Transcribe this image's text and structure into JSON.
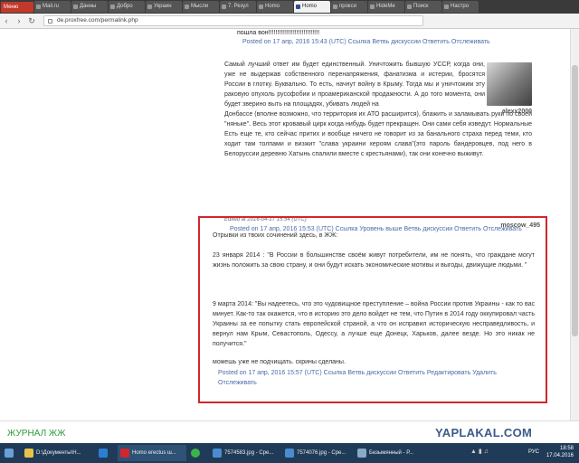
{
  "browser": {
    "menu_label": "Меню",
    "tabs": [
      {
        "label": "Mail.ru"
      },
      {
        "label": "Данны"
      },
      {
        "label": "Добро"
      },
      {
        "label": "Украин"
      },
      {
        "label": "Мысли"
      },
      {
        "label": "7. Резул"
      },
      {
        "label": "Homo"
      },
      {
        "label": "Homo",
        "active": true
      },
      {
        "label": "прокси"
      },
      {
        "label": "HideMe"
      },
      {
        "label": "Поиск"
      },
      {
        "label": "Настро"
      }
    ],
    "url": "de.proxfree.com/permalink.php"
  },
  "comments": {
    "top": {
      "truncated_text": "пошла вон!!!!!!!!!!!!!!!!!!!!!!!!!!!!!",
      "meta": "Posted on 17 апр, 2016 15:43 (UTC)  Ссылка Ветвь дискуссии Ответить Отслеживать"
    },
    "second": {
      "avatar_user": "alexx2000",
      "lead": "Самый лучший ответ им будет единственный. Уничтожить бывшую УССР, когда они, уже не выдержав собственного перенапряжения, фанатизма и истерии, бросятся России в глотку. Буквально. То есть, начнут войну в Крыму. Тогда мы и уничтожим эту раковую опухоль русофобии и проамериканской продажности. А до того момента, они будет зверино выть на площадях, убивать людей на",
      "body": "Донбассе (вполне возможно, что территория их АТО расширится), блажить и заламывать руки по своей \"няньке\". Весь этот кровавый цирк когда нибудь будет прекращен. Они сами себя изведут. Нормальные Есть еще те, кто сейчас притих и вообще ничего не говорит из за банального страха перед теми, кто ходит там толпами и визжит \"слава украини хероям слава\"(это пароль бандеровцев, под него в Белоруссии деревню Хатынь спалили вместе с крестьянами), так они конечно выживут.",
      "edited": "Edited at 2016-04-17 15:54 (UTC)",
      "meta": "Posted on 17 апр, 2016 15:53 (UTC)  Ссылка Уровень выше Ветвь дискуссии Ответить Отслеживать"
    },
    "third": {
      "user": "moscow_495",
      "intro": "Отрывки из твоих сочинений здесь, в ЖЖ:",
      "quote1": "23 января 2014 : \"В России в большинстве своём живут потребители, им не понять, что граждане могут жизнь положить за свою страну, и они будут искать экономические мотивы и выгоды, движущие людьми. \"",
      "quote2": "9 марта 2014: \"Вы надеетесь, что это чудовищное преступление – война России против Украины - как то вас минует. Как-то так окажется, что в историю это дело войдет не тем, что Путин в 2014 году оккупировал часть Украины за ее попытку стать европейской страной, а что он исправил историческую несправедливость, и вернул нам Крым, Севастополь, Одессу, а лучше еще Донецк, Харьков, далее везде. Но это никак не получится.\"",
      "closing": "можешь уже не подчищать. скрины сделаны.",
      "meta": "Posted on 17 апр, 2016 15:57 (UTC)  Ссылка Ветвь дискуссии Ответить Редактировать Удалить Отслеживать"
    }
  },
  "footer": {
    "journal_label": "ЖУРНАЛ ЖЖ",
    "logo": "YAPLAKAL.COM"
  },
  "taskbar": {
    "items": [
      {
        "label": "D:\\Документы\\Н..."
      },
      {
        "label": ""
      },
      {
        "label": "Homo erectus ш..."
      },
      {
        "label": ""
      },
      {
        "label": "7574583.jpg - Сре..."
      },
      {
        "label": "7574076.jpg - Сре..."
      },
      {
        "label": "Безымянный - Р..."
      }
    ],
    "lang": "РУС",
    "time": "18:58",
    "date": "17.04.2016"
  }
}
